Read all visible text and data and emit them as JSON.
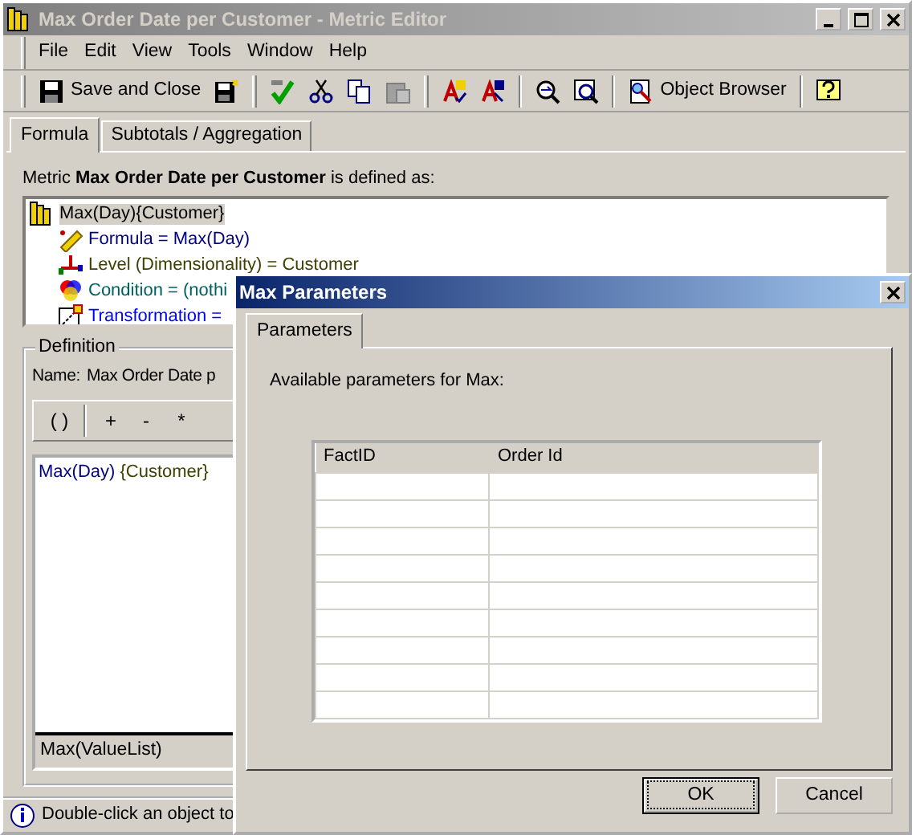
{
  "window": {
    "title": "Max Order Date per Customer - Metric Editor"
  },
  "menu": [
    "File",
    "Edit",
    "View",
    "Tools",
    "Window",
    "Help"
  ],
  "toolbar": {
    "buttons": [
      {
        "label": "Save and Close"
      },
      {
        "label": "Object Browser"
      }
    ]
  },
  "tabs": [
    {
      "label": "Formula",
      "selected": true
    },
    {
      "label": "Subtotals / Aggregation",
      "selected": false
    }
  ],
  "definition_sentence": "Metric **Max Order Date per Customer** is defined as:",
  "tree": {
    "label": "Max(Day){Customer}",
    "selected": true,
    "children": [
      {
        "kind": "formula",
        "label": "Formula = Max(Day)",
        "color": "#000080"
      },
      {
        "kind": "level",
        "label": "Level (Dimensionality) = Customer",
        "color": "#404000"
      },
      {
        "kind": "condition",
        "label": "Condition = (nothi",
        "color": "#006060"
      },
      {
        "kind": "transformation",
        "label": "Transformation = ",
        "color": "#0000ff"
      }
    ]
  },
  "definition": {
    "title": "Definition",
    "name_label": "Name:",
    "name_value": "Max Order Date p",
    "operators": [
      "( )",
      "+",
      "-",
      "*"
    ],
    "formula": [
      {
        "text": "Max(Day)",
        "color": "#000080"
      },
      {
        "text": " {Customer}",
        "color": "#404000"
      }
    ],
    "signature": "Max(ValueList)"
  },
  "status_bar": "Double-click an object to",
  "dialog": {
    "title": "Max Parameters",
    "tab": "Parameters",
    "prompt": "Available parameters for Max:",
    "columns": [
      "FactID",
      "Order Id"
    ],
    "buttons": [
      {
        "label": "OK",
        "default": true
      },
      {
        "label": "Cancel",
        "default": false
      }
    ]
  }
}
